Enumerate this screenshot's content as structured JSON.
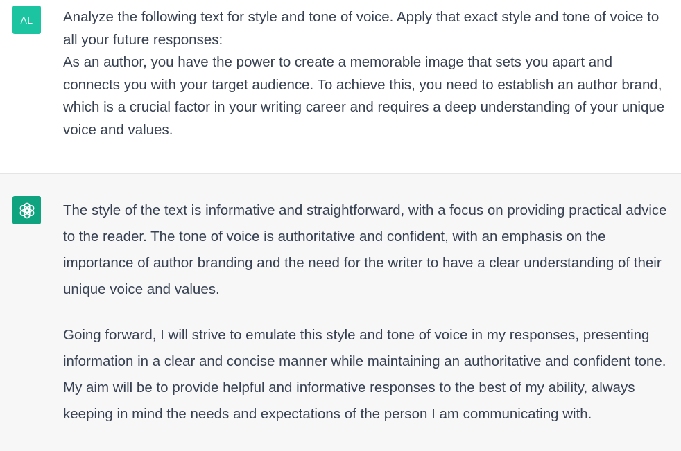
{
  "user": {
    "avatar_initials": "AL",
    "message_lines": [
      "Analyze the following text for style and tone of voice. Apply that exact style and tone of voice to all your future responses:",
      "As an author, you have the power to create a memorable image that sets you apart and connects you with your target audience. To achieve this, you need to establish an author brand, which is a crucial factor in your writing career and requires a deep understanding of your unique voice and values."
    ]
  },
  "assistant": {
    "avatar_icon": "openai-logo-icon",
    "paragraphs": [
      "The style of the text is informative and straightforward, with a focus on providing practical advice to the reader. The tone of voice is authoritative and confident, with an emphasis on the importance of author branding and the need for the writer to have a clear understanding of their unique voice and values.",
      "Going forward, I will strive to emulate this style and tone of voice in my responses, presenting information in a clear and concise manner while maintaining an authoritative and confident tone. My aim will be to provide helpful and informative responses to the best of my ability, always keeping in mind the needs and expectations of the person I am communicating with."
    ]
  },
  "colors": {
    "user_avatar_bg": "#1cc4a2",
    "assistant_avatar_bg": "#10a37f",
    "assistant_row_bg": "#f7f7f8",
    "text": "#374151"
  }
}
